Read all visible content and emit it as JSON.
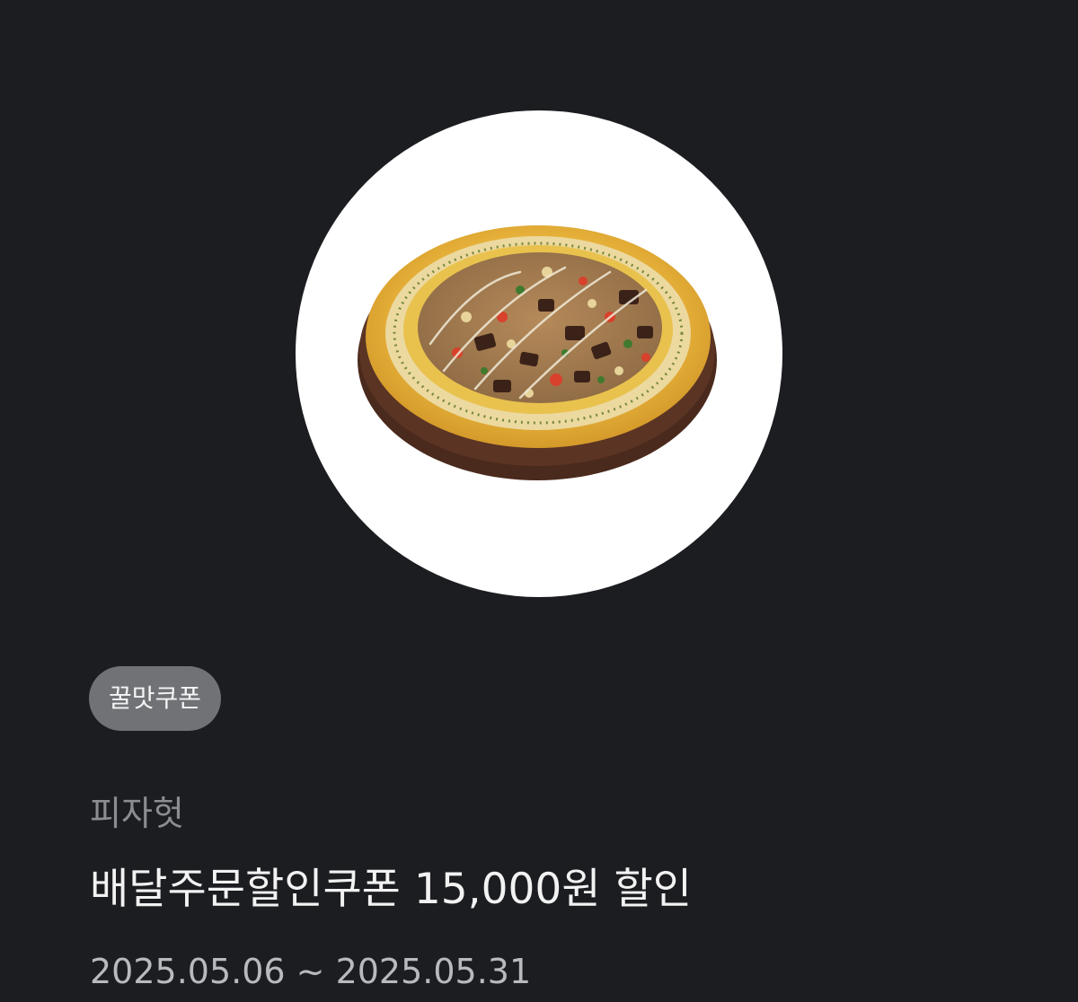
{
  "coupon": {
    "image_icon": "pizza-image",
    "badge": "꿀맛쿠폰",
    "brand": "피자헛",
    "title": "배달주문할인쿠폰 15,000원 할인",
    "period": "2025.05.06 ~ 2025.05.31"
  },
  "colors": {
    "background": "#1c1d21",
    "badge_bg": "#707276",
    "brand_text": "#8c8d91",
    "title_text": "#f2f2f3",
    "period_text": "#b9babd"
  }
}
